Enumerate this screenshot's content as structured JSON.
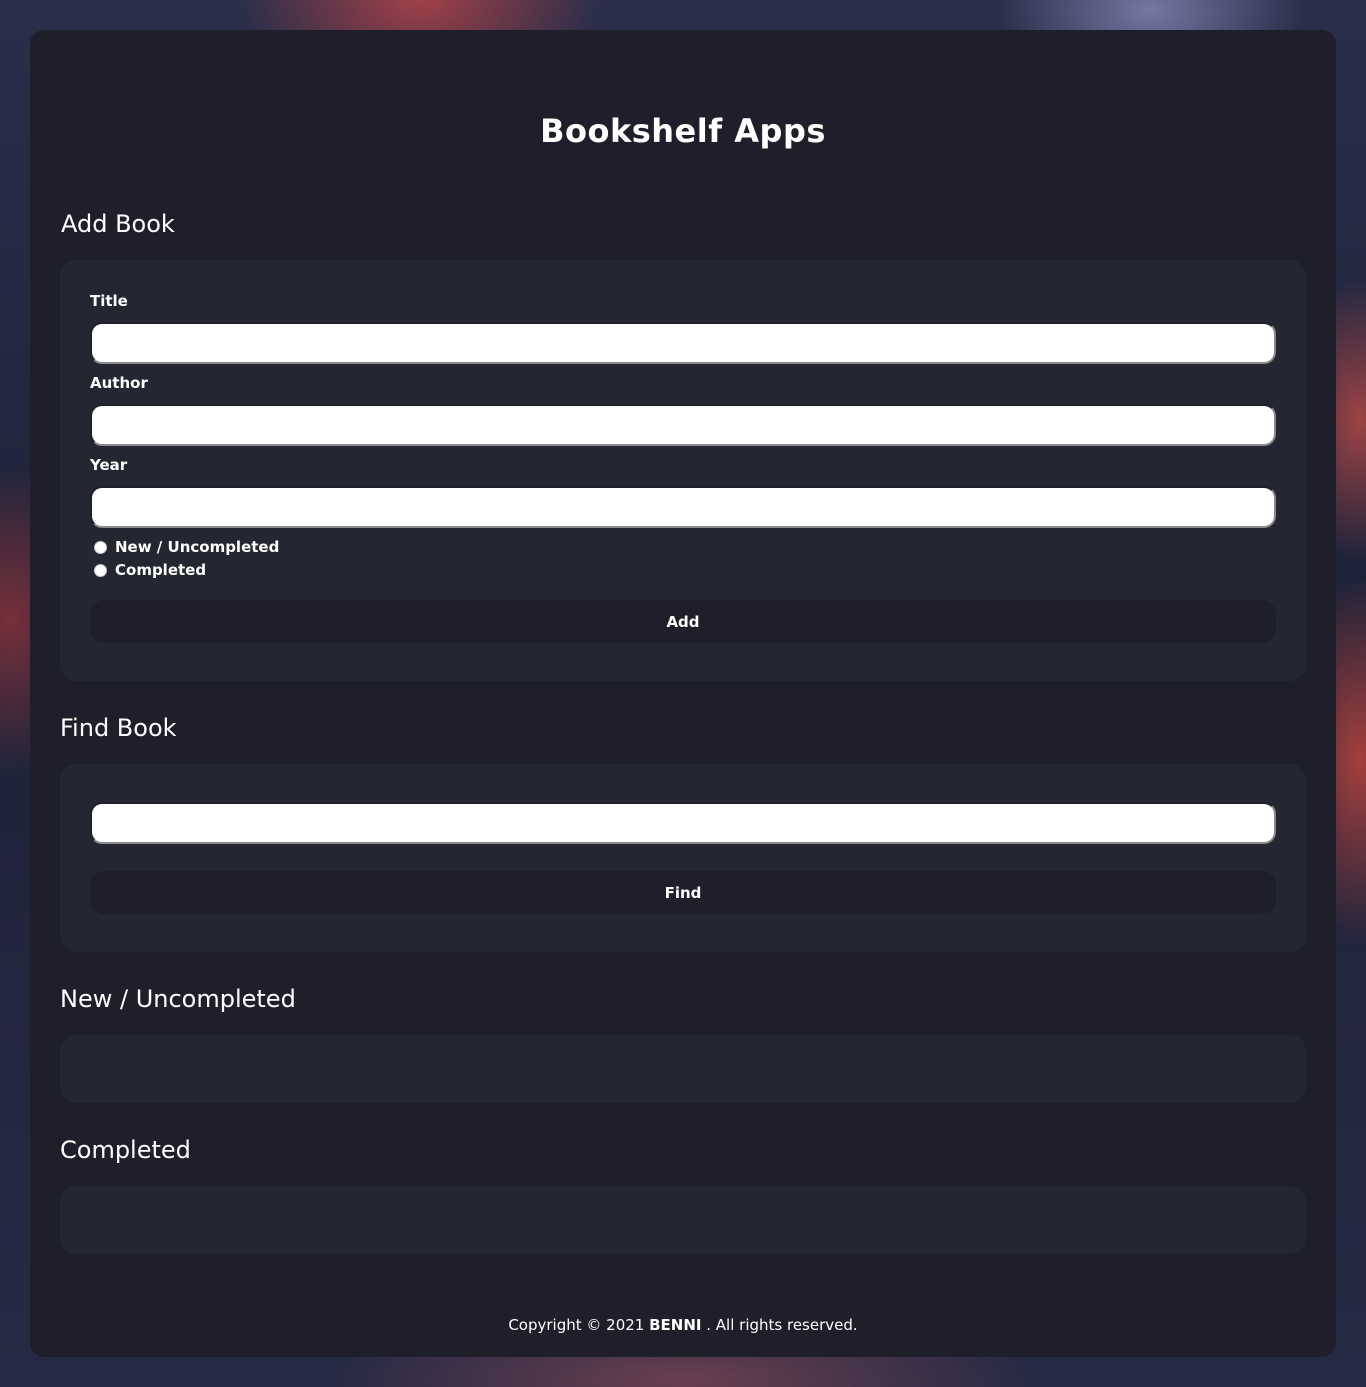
{
  "header": {
    "title": "Bookshelf Apps"
  },
  "add_book": {
    "heading": "Add Book",
    "title_label": "Title",
    "title_value": "",
    "author_label": "Author",
    "author_value": "",
    "year_label": "Year",
    "year_value": "",
    "radio_options": [
      "New / Uncompleted",
      "Completed"
    ],
    "button_label": "Add"
  },
  "find_book": {
    "heading": "Find Book",
    "search_value": "",
    "button_label": "Find"
  },
  "shelves": {
    "uncompleted_heading": "New / Uncompleted",
    "completed_heading": "Completed"
  },
  "footer": {
    "prefix": "Copyright © 2021 ",
    "brand": "BENNI",
    "suffix": " . All rights reserved."
  },
  "colors": {
    "card_bg": "#1f1e2b",
    "panel_bg": "#242732",
    "text": "#ffffff"
  }
}
